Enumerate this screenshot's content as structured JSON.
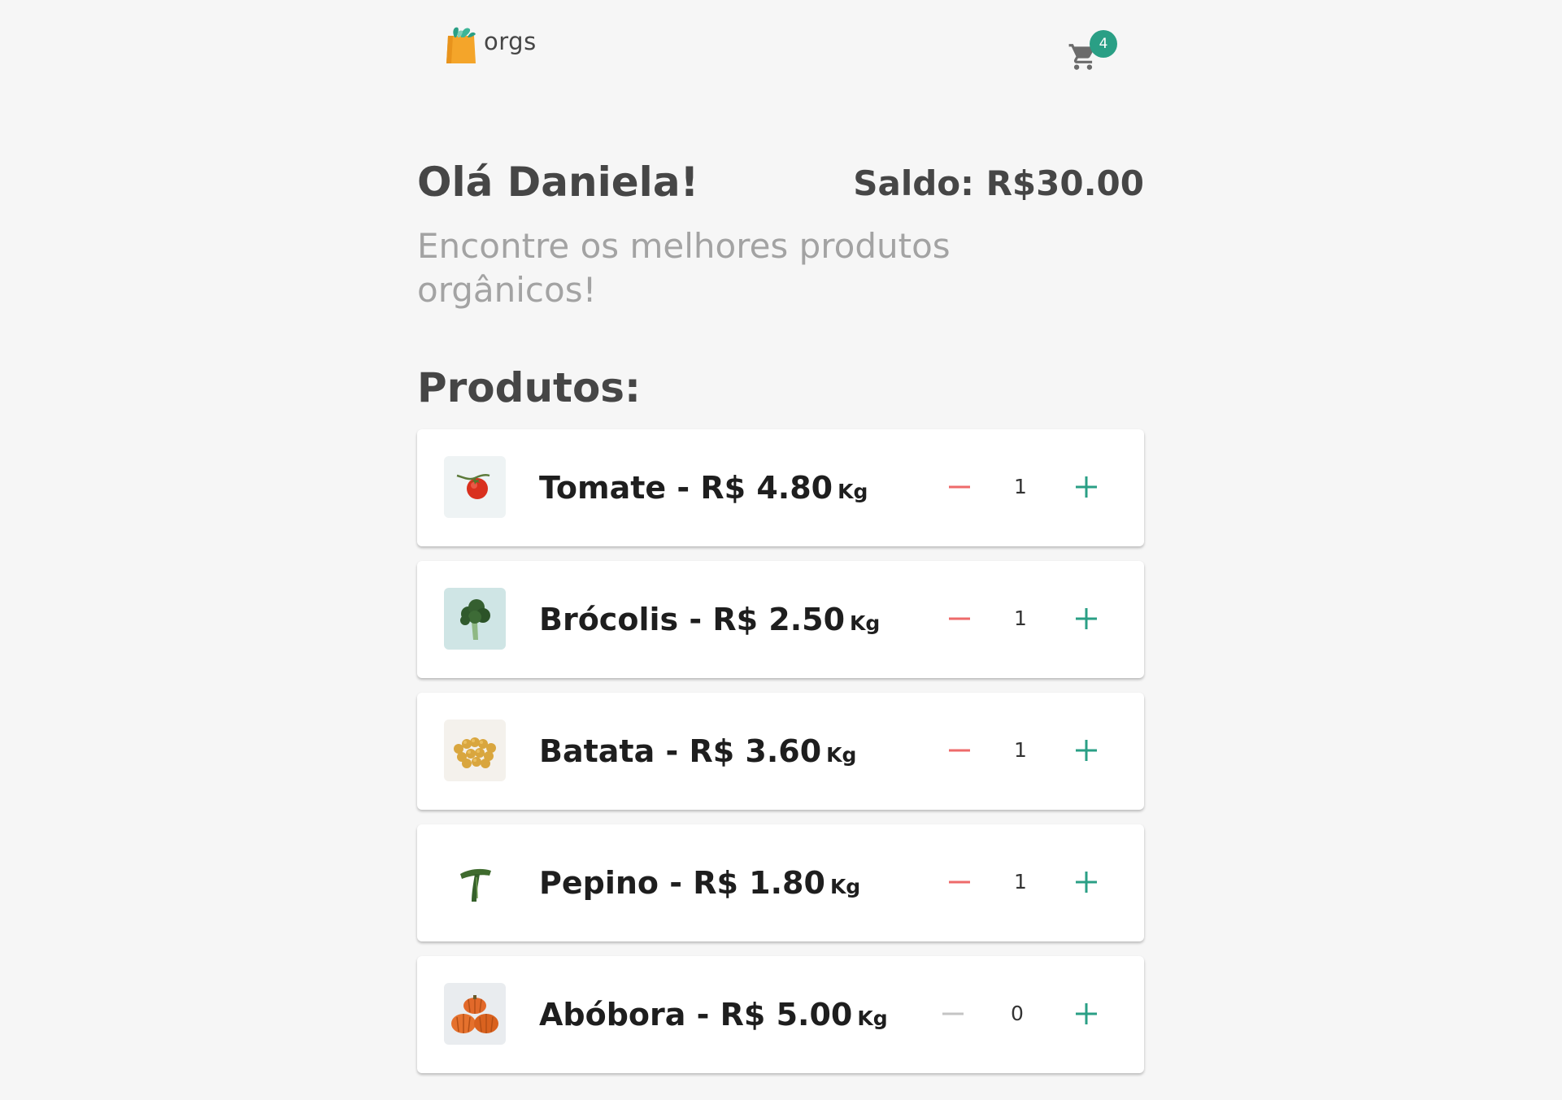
{
  "header": {
    "logo_text": "orgs",
    "cart_count": "4"
  },
  "greeting": "Olá Daniela!",
  "balance": "Saldo: R$30.00",
  "subtitle": "Encontre os melhores produtos orgânicos!",
  "section_title": "Produtos:",
  "products": [
    {
      "name": "Tomate - R$ 4.80",
      "unit": "Kg",
      "quantity": "1",
      "image": "tomato-image",
      "minus_enabled": true
    },
    {
      "name": "Brócolis - R$ 2.50",
      "unit": "Kg",
      "quantity": "1",
      "image": "broccoli-image",
      "minus_enabled": true
    },
    {
      "name": "Batata - R$ 3.60",
      "unit": "Kg",
      "quantity": "1",
      "image": "potato-image",
      "minus_enabled": true
    },
    {
      "name": "Pepino - R$ 1.80",
      "unit": "Kg",
      "quantity": "1",
      "image": "cucumber-image",
      "minus_enabled": true
    },
    {
      "name": "Abóbora - R$ 5.00",
      "unit": "Kg",
      "quantity": "0",
      "image": "pumpkin-image",
      "minus_enabled": false
    }
  ],
  "colors": {
    "accent": "#2a9f85",
    "minus_active": "#ee6a6a",
    "minus_disabled": "#c4c4c4",
    "text_dark": "#464646",
    "text_muted": "#a3a3a3",
    "background": "#f6f6f6"
  },
  "icons": {
    "logo": "shopping-bag-icon",
    "cart": "cart-icon",
    "minus": "minus-icon",
    "plus": "plus-icon"
  }
}
